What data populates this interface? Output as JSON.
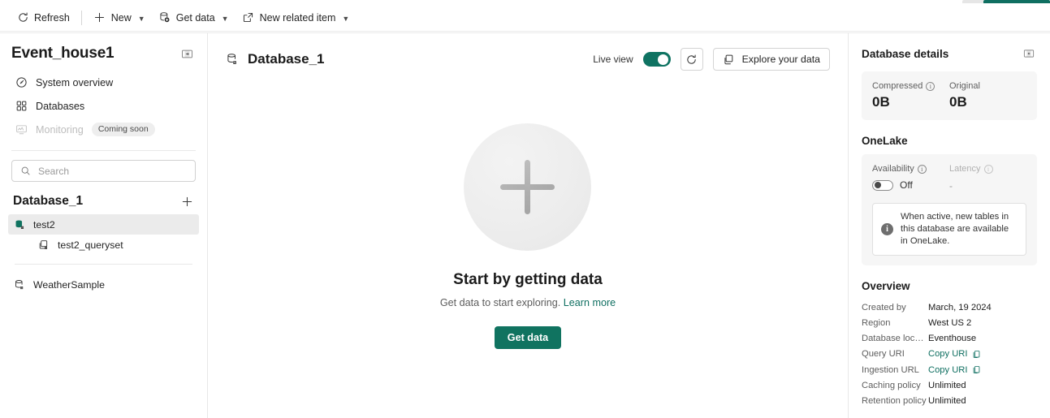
{
  "toolbar": {
    "refresh": "Refresh",
    "new": "New",
    "get_data": "Get data",
    "new_related_item": "New related item"
  },
  "sidebar": {
    "title": "Event_house1",
    "collapse_title": "Collapse pane",
    "items": [
      {
        "label": "System overview",
        "icon": "speedometer-icon",
        "disabled": false,
        "badge": ""
      },
      {
        "label": "Databases",
        "icon": "grid-icon",
        "disabled": false,
        "badge": ""
      },
      {
        "label": "Monitoring",
        "icon": "monitor-icon",
        "disabled": true,
        "badge": "Coming soon"
      }
    ],
    "search": {
      "placeholder": "Search",
      "value": ""
    },
    "database_section": {
      "title": "Database_1",
      "add_label": "+"
    },
    "tree": [
      {
        "label": "test2",
        "icon": "database-icon",
        "selected": true,
        "indent": false
      },
      {
        "label": "test2_queryset",
        "icon": "queryset-icon",
        "selected": false,
        "indent": true
      },
      {
        "label": "WeatherSample",
        "icon": "database-outline-icon",
        "selected": false,
        "indent": false
      }
    ]
  },
  "main": {
    "title": "Database_1",
    "live_view_label": "Live view",
    "live_view_on": true,
    "refresh_label": "Refresh",
    "explore_label": "Explore your data",
    "empty": {
      "title": "Start by getting data",
      "subtitle": "Get data to start exploring.",
      "link": "Learn more",
      "button": "Get data"
    }
  },
  "details": {
    "title": "Database details",
    "stats": [
      {
        "label": "Compressed",
        "value": "0B",
        "info": true,
        "muted": false
      },
      {
        "label": "Original",
        "value": "0B",
        "info": false,
        "muted": false
      }
    ],
    "onelake": {
      "title": "OneLake",
      "availability_label": "Availability",
      "availability_state": "Off",
      "availability_on": false,
      "latency_label": "Latency",
      "latency_value": "-",
      "note": "When active, new tables in this database are available in OneLake."
    },
    "overview": {
      "title": "Overview",
      "rows": [
        {
          "key": "Created by",
          "value": "March, 19 2024",
          "link": false,
          "copy": false
        },
        {
          "key": "Region",
          "value": "West US 2",
          "link": false,
          "copy": false
        },
        {
          "key": "Database locati…",
          "value": "Eventhouse",
          "link": false,
          "copy": false
        },
        {
          "key": "Query URI",
          "value": "Copy URI",
          "link": true,
          "copy": true
        },
        {
          "key": "Ingestion URL",
          "value": "Copy URI",
          "link": true,
          "copy": true
        },
        {
          "key": "Caching policy",
          "value": "Unlimited",
          "link": false,
          "copy": false
        },
        {
          "key": "Retention policy",
          "value": "Unlimited",
          "link": false,
          "copy": false
        }
      ]
    }
  },
  "colors": {
    "accent": "#107360",
    "toggle_on": "#0f7362",
    "link": "#0f6f61",
    "selected_row": "#ebebeb"
  }
}
